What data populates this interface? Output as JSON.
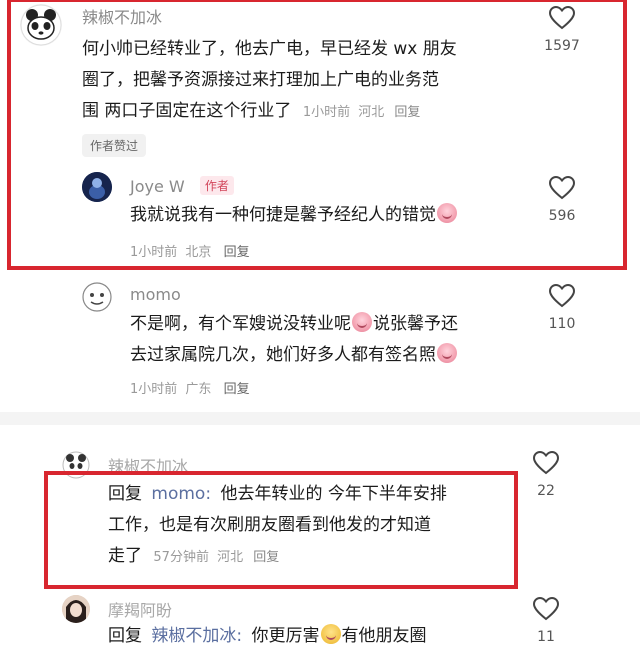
{
  "comments": [
    {
      "username": "辣椒不加冰",
      "text_lines": [
        "何小帅已经转业了，他去广电，早已经发 wx 朋友",
        "圈了，把馨予资源接过来打理加上广电的业务范",
        "围 两口子固定在这个行业了"
      ],
      "time": "1小时前",
      "location": "河北",
      "reply_label": "回复",
      "likes": "1597",
      "author_liked": "作者赞过"
    },
    {
      "username": "Joye W",
      "author_tag": "作者",
      "text": "我就说我有一种何捷是馨予经纪人的错觉",
      "time": "1小时前",
      "location": "北京",
      "reply_label": "回复",
      "likes": "596"
    },
    {
      "username": "momo",
      "text_line1": "不是啊，有个军嫂说没转业呢",
      "text_line1b": "说张馨予还",
      "text_line2": "去过家属院几次，她们好多人都有签名照",
      "time": "1小时前",
      "location": "广东",
      "reply_label": "回复",
      "likes": "110"
    },
    {
      "username": "辣椒不加冰",
      "reply_prefix": "回复",
      "mention": "momo:",
      "text_line1": "他去年转业的 今年下半年安排",
      "text_line2": "工作，也是有次刷朋友圈看到他发的才知道",
      "text_line3": "走了",
      "time": "57分钟前",
      "location": "河北",
      "reply_label": "回复",
      "likes": "22"
    },
    {
      "username": "摩羯阿盼",
      "reply_prefix": "回复",
      "mention": "辣椒不加冰:",
      "text_a": "你更厉害",
      "text_b": "有他朋友圈",
      "likes": "11"
    }
  ],
  "icons": {
    "like": "heart-outline-icon"
  },
  "colors": {
    "highlight_box": "#d8262f",
    "author_tag": "#d2455a"
  }
}
